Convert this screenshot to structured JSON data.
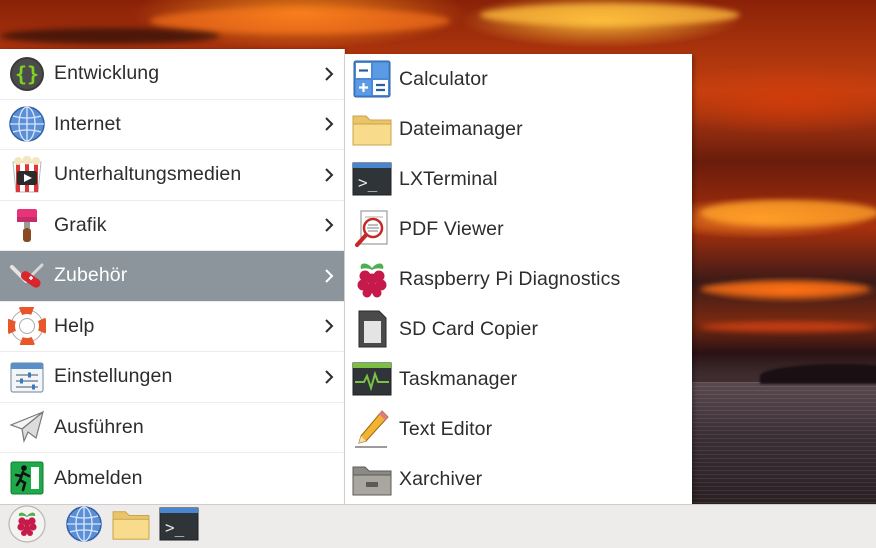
{
  "main_menu": {
    "items": [
      {
        "label": "Entwicklung",
        "icon": "code-braces-icon",
        "has_submenu": true
      },
      {
        "label": "Internet",
        "icon": "globe-icon",
        "has_submenu": true
      },
      {
        "label": "Unterhaltungsmedien",
        "icon": "popcorn-play-icon",
        "has_submenu": true
      },
      {
        "label": "Grafik",
        "icon": "paint-brush-icon",
        "has_submenu": true
      },
      {
        "label": "Zubehör",
        "icon": "swiss-knife-icon",
        "has_submenu": true,
        "selected": true
      },
      {
        "label": "Help",
        "icon": "lifebuoy-icon",
        "has_submenu": true
      },
      {
        "label": "Einstellungen",
        "icon": "sliders-icon",
        "has_submenu": true
      },
      {
        "label": "Ausführen",
        "icon": "paper-plane-icon",
        "has_submenu": false
      },
      {
        "label": "Abmelden",
        "icon": "exit-runner-icon",
        "has_submenu": false
      }
    ]
  },
  "sub_menu": {
    "items": [
      {
        "label": "Calculator",
        "icon": "calculator-icon"
      },
      {
        "label": "Dateimanager",
        "icon": "folder-icon"
      },
      {
        "label": "LXTerminal",
        "icon": "terminal-icon"
      },
      {
        "label": "PDF Viewer",
        "icon": "pdf-magnifier-icon"
      },
      {
        "label": "Raspberry Pi Diagnostics",
        "icon": "raspberry-icon"
      },
      {
        "label": "SD Card Copier",
        "icon": "sd-card-icon"
      },
      {
        "label": "Taskmanager",
        "icon": "heartbeat-monitor-icon"
      },
      {
        "label": "Text Editor",
        "icon": "pencil-icon"
      },
      {
        "label": "Xarchiver",
        "icon": "archive-box-icon"
      }
    ]
  },
  "taskbar": {
    "buttons": [
      {
        "name": "raspberry-menu-button",
        "icon": "raspberry-icon"
      },
      {
        "name": "browser-launcher",
        "icon": "globe-icon"
      },
      {
        "name": "file-manager-launcher",
        "icon": "folder-icon"
      },
      {
        "name": "terminal-launcher",
        "icon": "terminal-icon"
      }
    ]
  },
  "colors": {
    "menu_background": "#ffffff",
    "selected_item": "#8c959c",
    "text": "#2d2d2d",
    "taskbar": "#edecea"
  }
}
